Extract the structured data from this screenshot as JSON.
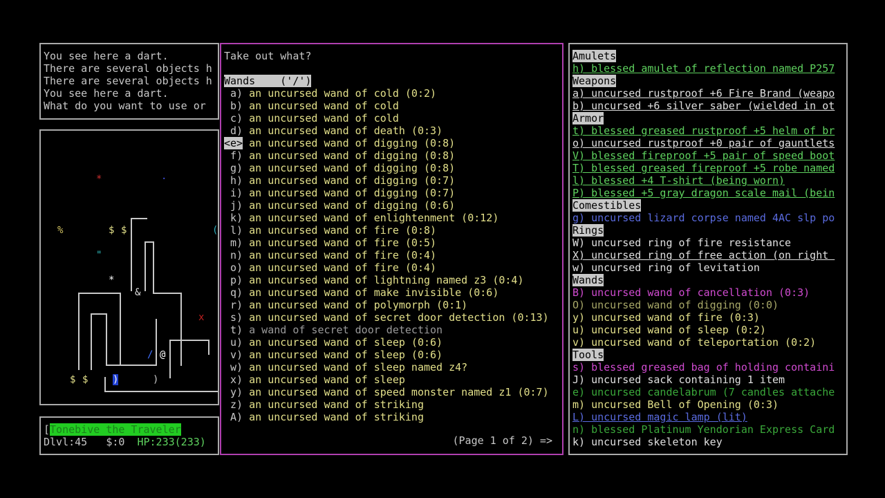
{
  "messages": [
    "You see here a dart.",
    "There are several objects h",
    "There are several objects h",
    "You see here a dart.",
    "What do you want to use or "
  ],
  "menu": {
    "prompt": "Take out what?",
    "category": "Wands    ('/')",
    "items": [
      {
        "key": "a)",
        "text": "an uncursed wand of cold (0:2)",
        "color": "c-yellow",
        "selected": false
      },
      {
        "key": "b)",
        "text": "an uncursed wand of cold",
        "color": "c-yellow",
        "selected": false
      },
      {
        "key": "c)",
        "text": "an uncursed wand of cold",
        "color": "c-yellow",
        "selected": false
      },
      {
        "key": "d)",
        "text": "an uncursed wand of death (0:3)",
        "color": "c-yellow",
        "selected": false
      },
      {
        "key": "<e>",
        "text": "an uncursed wand of digging (0:8)",
        "color": "c-yellow",
        "selected": true
      },
      {
        "key": "f)",
        "text": "an uncursed wand of digging (0:8)",
        "color": "c-yellow",
        "selected": false
      },
      {
        "key": "g)",
        "text": "an uncursed wand of digging (0:8)",
        "color": "c-yellow",
        "selected": false
      },
      {
        "key": "h)",
        "text": "an uncursed wand of digging (0:7)",
        "color": "c-yellow",
        "selected": false
      },
      {
        "key": "i)",
        "text": "an uncursed wand of digging (0:7)",
        "color": "c-yellow",
        "selected": false
      },
      {
        "key": "j)",
        "text": "an uncursed wand of digging (0:6)",
        "color": "c-yellow",
        "selected": false
      },
      {
        "key": "k)",
        "text": "an uncursed wand of enlightenment (0:12)",
        "color": "c-yellow",
        "selected": false
      },
      {
        "key": "l)",
        "text": "an uncursed wand of fire (0:8)",
        "color": "c-yellow",
        "selected": false
      },
      {
        "key": "m)",
        "text": "an uncursed wand of fire (0:5)",
        "color": "c-yellow",
        "selected": false
      },
      {
        "key": "n)",
        "text": "an uncursed wand of fire (0:4)",
        "color": "c-yellow",
        "selected": false
      },
      {
        "key": "o)",
        "text": "an uncursed wand of fire (0:4)",
        "color": "c-yellow",
        "selected": false
      },
      {
        "key": "p)",
        "text": "an uncursed wand of lightning named z3 (0:4)",
        "color": "c-yellow",
        "selected": false
      },
      {
        "key": "q)",
        "text": "an uncursed wand of make invisible (0:6)",
        "color": "c-yellow",
        "selected": false
      },
      {
        "key": "r)",
        "text": "an uncursed wand of polymorph (0:1)",
        "color": "c-yellow",
        "selected": false
      },
      {
        "key": "s)",
        "text": "an uncursed wand of secret door detection (0:13)",
        "color": "c-yellow",
        "selected": false
      },
      {
        "key": "t)",
        "text": "a wand of secret door detection",
        "color": "c-gray",
        "selected": false
      },
      {
        "key": "u)",
        "text": "an uncursed wand of sleep (0:6)",
        "color": "c-yellow",
        "selected": false
      },
      {
        "key": "v)",
        "text": "an uncursed wand of sleep (0:6)",
        "color": "c-yellow",
        "selected": false
      },
      {
        "key": "w)",
        "text": "an uncursed wand of sleep named z4?",
        "color": "c-yellow",
        "selected": false
      },
      {
        "key": "x)",
        "text": "an uncursed wand of sleep",
        "color": "c-yellow",
        "selected": false
      },
      {
        "key": "y)",
        "text": "an uncursed wand of speed monster named z1 (0:7)",
        "color": "c-yellow",
        "selected": false
      },
      {
        "key": "z)",
        "text": "an uncursed wand of striking",
        "color": "c-yellow",
        "selected": false
      },
      {
        "key": "A)",
        "text": "an uncursed wand of striking",
        "color": "c-yellow",
        "selected": false
      }
    ],
    "page_indicator": "(Page 1 of 2) =>"
  },
  "inventory": [
    {
      "type": "header",
      "text": "Amulets"
    },
    {
      "type": "item",
      "text": "h) blessed amulet of reflection named P257",
      "color": "c-green",
      "ul": true
    },
    {
      "type": "header",
      "text": "Weapons"
    },
    {
      "type": "item",
      "text": "a) uncursed rustproof +6 Fire Brand (weapo",
      "color": "c-def",
      "ul": true
    },
    {
      "type": "item",
      "text": "b) uncursed +6 silver saber (wielded in ot",
      "color": "c-def",
      "ul": true
    },
    {
      "type": "header",
      "text": "Armor"
    },
    {
      "type": "item",
      "text": "t) blessed greased rustproof +5 helm of br",
      "color": "c-green",
      "ul": true
    },
    {
      "type": "item",
      "text": "o) uncursed rustproof +0 pair of gauntlets",
      "color": "c-def",
      "ul": true
    },
    {
      "type": "item",
      "text": "V) blessed fireproof +5 pair of speed boot",
      "color": "c-green",
      "ul": true
    },
    {
      "type": "item",
      "text": "T) blessed greased fireproof +5 robe named",
      "color": "c-green",
      "ul": true
    },
    {
      "type": "item",
      "text": "l) blessed +4 T-shirt (being worn)",
      "color": "c-green",
      "ul": true
    },
    {
      "type": "item",
      "text": "P) blessed +5 gray dragon scale mail (bein",
      "color": "c-green",
      "ul": true
    },
    {
      "type": "header",
      "text": "Comestibles"
    },
    {
      "type": "item",
      "text": "g) uncursed lizard corpse named 4AC slp po",
      "color": "c-blue",
      "ul": false
    },
    {
      "type": "header",
      "text": "Rings"
    },
    {
      "type": "item",
      "text": "W) uncursed ring of fire resistance",
      "color": "c-def",
      "ul": false
    },
    {
      "type": "item",
      "text": "X) uncursed ring of free action (on right ",
      "color": "c-def",
      "ul": true
    },
    {
      "type": "item",
      "text": "w) uncursed ring of levitation",
      "color": "c-def",
      "ul": false
    },
    {
      "type": "header",
      "text": "Wands"
    },
    {
      "type": "item",
      "text": "B) uncursed wand of cancellation (0:3)",
      "color": "c-magenta",
      "ul": false
    },
    {
      "type": "item",
      "text": "O) uncursed wand of digging (0:0)",
      "color": "c-olive",
      "ul": false
    },
    {
      "type": "item",
      "text": "y) uncursed wand of fire (0:3)",
      "color": "c-yellow",
      "ul": false
    },
    {
      "type": "item",
      "text": "u) uncursed wand of sleep (0:2)",
      "color": "c-yellow",
      "ul": false
    },
    {
      "type": "item",
      "text": "v) uncursed wand of teleportation (0:2)",
      "color": "c-yellow",
      "ul": false
    },
    {
      "type": "header",
      "text": "Tools"
    },
    {
      "type": "item",
      "text": "s) blessed greased bag of holding containi",
      "color": "c-magenta",
      "ul": false
    },
    {
      "type": "item",
      "text": "J) uncursed sack containing 1 item",
      "color": "c-def",
      "ul": false
    },
    {
      "type": "item",
      "text": "e) uncursed candelabrum (7 candles attache",
      "color": "c-dkgreen",
      "ul": false
    },
    {
      "type": "item",
      "text": "m) uncursed Bell of Opening (0:3)",
      "color": "c-yellow",
      "ul": false
    },
    {
      "type": "item",
      "text": "L) uncursed magic lamp (lit)",
      "color": "c-blue",
      "ul": true
    },
    {
      "type": "item",
      "text": "n) blessed Platinum Yendorian Express Card",
      "color": "c-dkgreen",
      "ul": false
    },
    {
      "type": "item",
      "text": "k) uncursed skeleton key",
      "color": "c-def",
      "ul": false
    }
  ],
  "status": {
    "name_bracket": "[",
    "name": "Tonebive the Traveler",
    "dlvl": "Dlvl:45",
    "gold": "$:0",
    "hp": "HP:233",
    "hpmax": "(233)"
  },
  "map_glyphs": {
    "red_star": "*",
    "blue_dot": "·",
    "percent": "%",
    "dollar": "$",
    "quote": "\"",
    "star": "*",
    "ampersand": "&",
    "red_x": "x",
    "wand": "/",
    "player": "@",
    "ring_item": ")",
    "paren_cyan": "("
  },
  "colors": {
    "menu_border": "#b040b0",
    "panel_border": "#aaaaaa",
    "hp_bar": "#22cc22"
  }
}
